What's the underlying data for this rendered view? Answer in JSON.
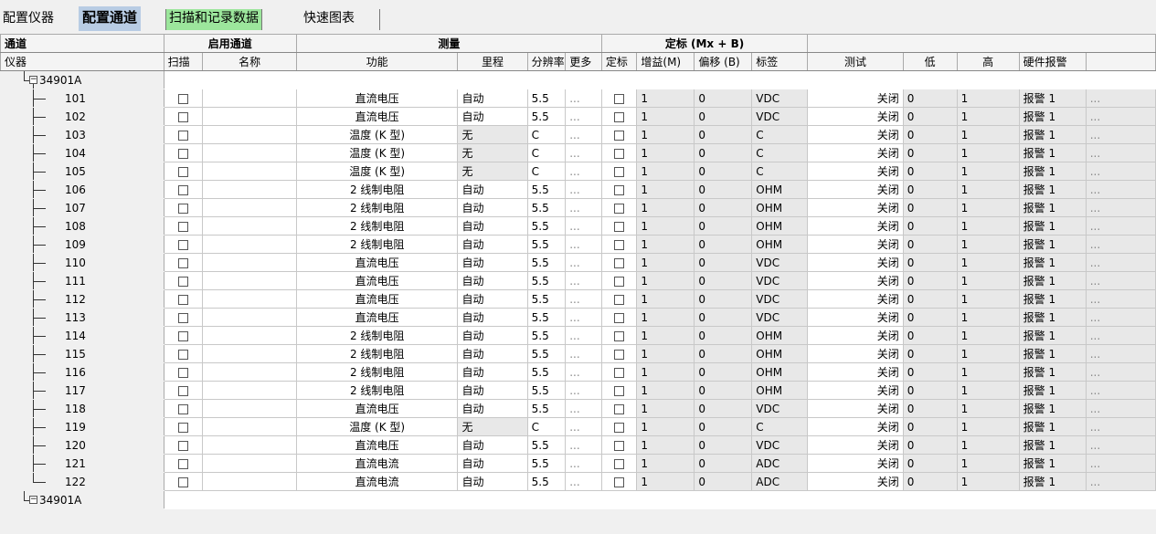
{
  "tabs": [
    "配置仪器",
    "配置通道",
    "扫描和记录数据",
    "快速图表"
  ],
  "header_groups": {
    "channel": "通道",
    "enable": "启用通道",
    "measure": "测量",
    "scale": "定标 (Mx + B)"
  },
  "columns": {
    "instrument": "仪器",
    "scan": "扫描",
    "name": "名称",
    "function": "功能",
    "range": "里程",
    "resolution": "分辨率",
    "more": "更多",
    "scaling": "定标",
    "gain": "增益(M)",
    "offset": "偏移 (B)",
    "label": "标签",
    "test": "测试",
    "low": "低",
    "high": "高",
    "hw_alarm": "硬件报警"
  },
  "instruments": [
    "34901A",
    "34901A"
  ],
  "rows": [
    {
      "ch": "101",
      "func": "直流电压",
      "range": "自动",
      "res": "5.5",
      "label": "VDC"
    },
    {
      "ch": "102",
      "func": "直流电压",
      "range": "自动",
      "res": "5.5",
      "label": "VDC"
    },
    {
      "ch": "103",
      "func": "温度 (K 型)",
      "range": "无",
      "res": "C",
      "label": "C"
    },
    {
      "ch": "104",
      "func": "温度 (K 型)",
      "range": "无",
      "res": "C",
      "label": "C"
    },
    {
      "ch": "105",
      "func": "温度 (K 型)",
      "range": "无",
      "res": "C",
      "label": "C"
    },
    {
      "ch": "106",
      "func": "2 线制电阻",
      "range": "自动",
      "res": "5.5",
      "label": "OHM"
    },
    {
      "ch": "107",
      "func": "2 线制电阻",
      "range": "自动",
      "res": "5.5",
      "label": "OHM"
    },
    {
      "ch": "108",
      "func": "2 线制电阻",
      "range": "自动",
      "res": "5.5",
      "label": "OHM"
    },
    {
      "ch": "109",
      "func": "2 线制电阻",
      "range": "自动",
      "res": "5.5",
      "label": "OHM"
    },
    {
      "ch": "110",
      "func": "直流电压",
      "range": "自动",
      "res": "5.5",
      "label": "VDC"
    },
    {
      "ch": "111",
      "func": "直流电压",
      "range": "自动",
      "res": "5.5",
      "label": "VDC"
    },
    {
      "ch": "112",
      "func": "直流电压",
      "range": "自动",
      "res": "5.5",
      "label": "VDC"
    },
    {
      "ch": "113",
      "func": "直流电压",
      "range": "自动",
      "res": "5.5",
      "label": "VDC"
    },
    {
      "ch": "114",
      "func": "2 线制电阻",
      "range": "自动",
      "res": "5.5",
      "label": "OHM"
    },
    {
      "ch": "115",
      "func": "2 线制电阻",
      "range": "自动",
      "res": "5.5",
      "label": "OHM"
    },
    {
      "ch": "116",
      "func": "2 线制电阻",
      "range": "自动",
      "res": "5.5",
      "label": "OHM"
    },
    {
      "ch": "117",
      "func": "2 线制电阻",
      "range": "自动",
      "res": "5.5",
      "label": "OHM"
    },
    {
      "ch": "118",
      "func": "直流电压",
      "range": "自动",
      "res": "5.5",
      "label": "VDC"
    },
    {
      "ch": "119",
      "func": "温度 (K 型)",
      "range": "无",
      "res": "C",
      "label": "C"
    },
    {
      "ch": "120",
      "func": "直流电压",
      "range": "自动",
      "res": "5.5",
      "label": "VDC"
    },
    {
      "ch": "121",
      "func": "直流电流",
      "range": "自动",
      "res": "5.5",
      "label": "ADC"
    },
    {
      "ch": "122",
      "func": "直流电流",
      "range": "自动",
      "res": "5.5",
      "label": "ADC"
    }
  ],
  "defaults": {
    "more": "...",
    "gain": "1",
    "offset": "0",
    "test": "关闭",
    "low": "0",
    "high": "1",
    "alarm": "报警 1",
    "alarm_more": "..."
  }
}
